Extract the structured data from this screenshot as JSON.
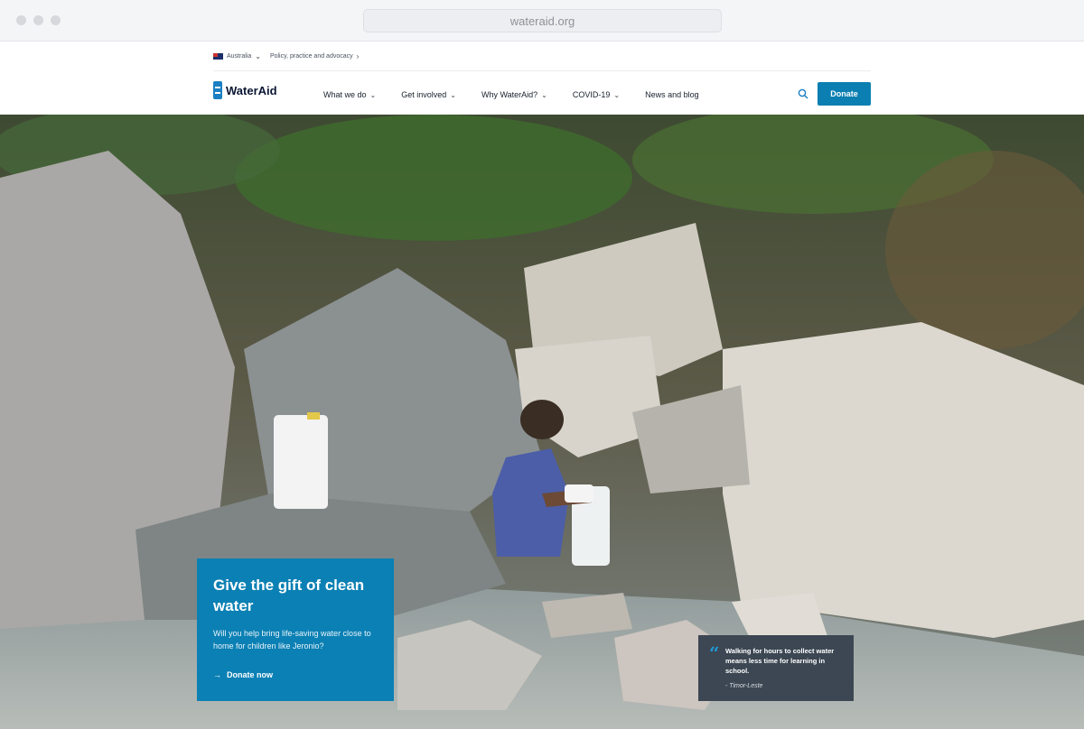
{
  "browser": {
    "url": "wateraid.org"
  },
  "utility": {
    "country": "Australia",
    "link": "Policy, practice and advocacy"
  },
  "header": {
    "brand": "WaterAid",
    "nav": [
      {
        "label": "What we do",
        "has_dropdown": true
      },
      {
        "label": "Get involved",
        "has_dropdown": true
      },
      {
        "label": "Why WaterAid?",
        "has_dropdown": true
      },
      {
        "label": "COVID-19",
        "has_dropdown": true
      },
      {
        "label": "News and blog",
        "has_dropdown": false
      }
    ],
    "search_icon": "search-icon",
    "donate_label": "Donate"
  },
  "hero": {
    "cta_title": "Give the gift of clean water",
    "cta_body": "Will you help bring life-saving water close to home for children like Jeronio?",
    "cta_link": "Donate now",
    "quote_text": "Walking for hours to collect water means less time for learning in school.",
    "quote_attribution": "- Timor-Leste"
  },
  "colors": {
    "brand_blue": "#0b7fb1",
    "quote_bg": "#3c4753"
  }
}
